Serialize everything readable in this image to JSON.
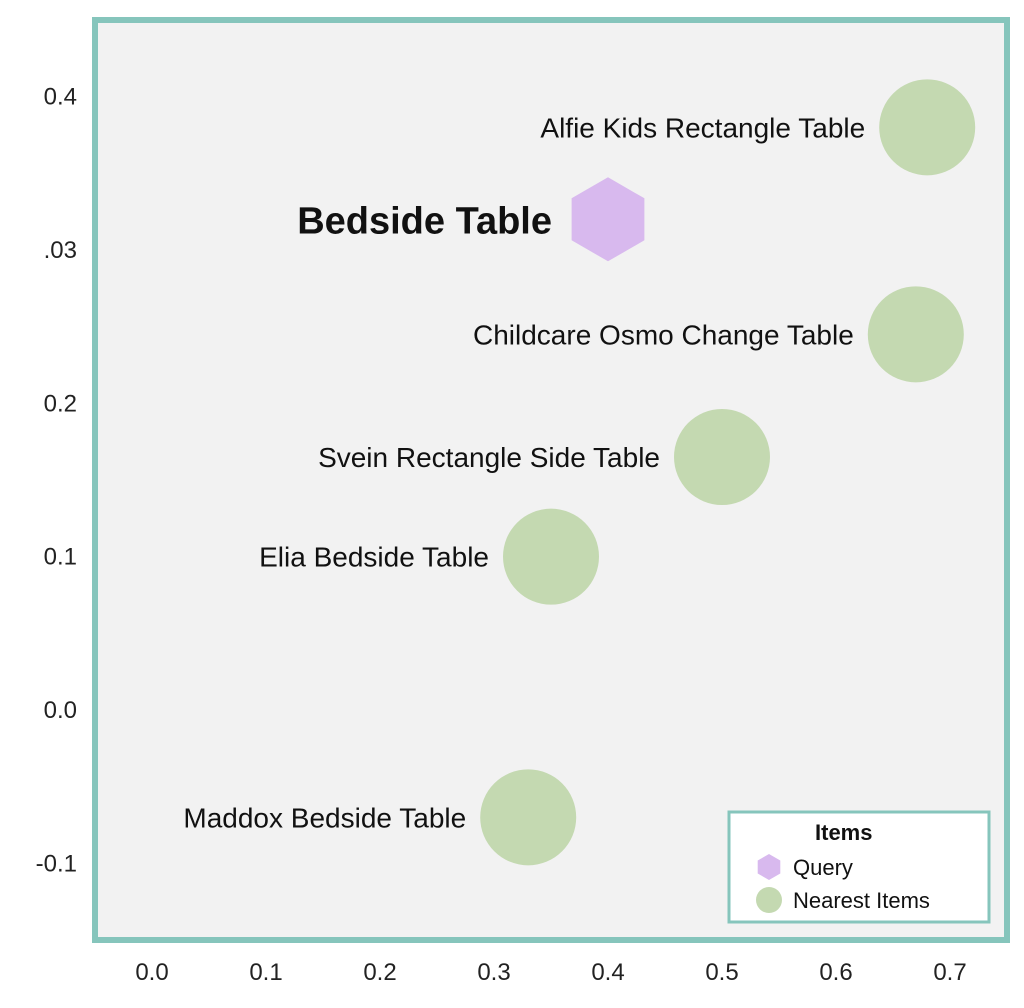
{
  "chart_data": {
    "type": "scatter",
    "xlim": [
      -0.05,
      0.75
    ],
    "ylim": [
      -0.15,
      0.45
    ],
    "x_ticks": [
      0.0,
      0.1,
      0.2,
      0.3,
      0.4,
      0.5,
      0.6,
      0.7
    ],
    "y_ticks": [
      -0.1,
      0.0,
      0.1,
      0.2,
      0.3,
      0.4
    ],
    "x_tick_labels": [
      "0.0",
      "0.1",
      "0.2",
      "0.3",
      "0.4",
      "0.5",
      "0.6",
      "0.7"
    ],
    "y_tick_labels": [
      "-0.1",
      "0.0",
      "0.1",
      "0.2",
      ".03",
      "0.4"
    ],
    "query": {
      "label": "Bedside Table",
      "x": 0.4,
      "y": 0.32
    },
    "nearest_items": [
      {
        "label": "Alfie Kids Rectangle Table",
        "x": 0.68,
        "y": 0.38
      },
      {
        "label": "Childcare Osmo Change Table",
        "x": 0.67,
        "y": 0.245
      },
      {
        "label": "Svein Rectangle Side Table",
        "x": 0.5,
        "y": 0.165
      },
      {
        "label": "Elia Bedside Table",
        "x": 0.35,
        "y": 0.1
      },
      {
        "label": "Maddox Bedside Table",
        "x": 0.33,
        "y": -0.07
      }
    ],
    "legend": {
      "title": "Items",
      "entries": [
        {
          "key": "query",
          "label": "Query"
        },
        {
          "key": "nearest",
          "label": "Nearest Items"
        }
      ]
    }
  }
}
